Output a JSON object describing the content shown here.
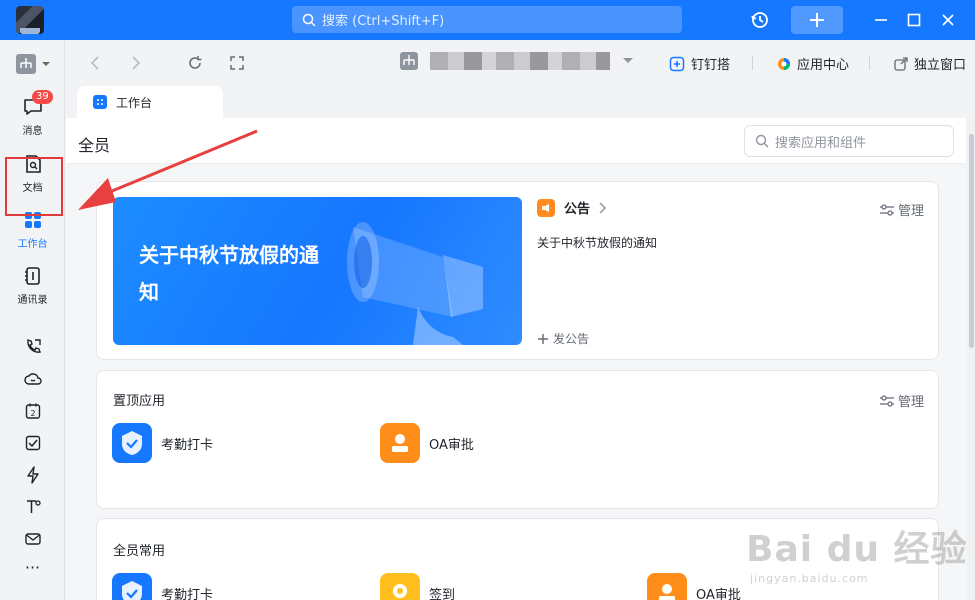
{
  "titlebar": {
    "search_placeholder": "搜索 (Ctrl+Shift+F)"
  },
  "rail": {
    "items": [
      {
        "label": "消息",
        "icon": "message-icon",
        "badge": "39"
      },
      {
        "label": "文档",
        "icon": "doc-icon"
      },
      {
        "label": "工作台",
        "icon": "workbench-icon"
      },
      {
        "label": "通讯录",
        "icon": "contacts-icon"
      }
    ],
    "small_icons": [
      "phone-icon",
      "cloud-icon",
      "calendar-icon",
      "todo-icon",
      "flash-icon",
      "pin-icon",
      "mail-icon",
      "more-icon"
    ],
    "calendar_day": "2",
    "more_glyph": "···"
  },
  "nav": {
    "links": {
      "dingdingda": "钉钉搭",
      "app_center": "应用中心",
      "detach": "独立窗口"
    }
  },
  "tab": {
    "label": "工作台"
  },
  "content": {
    "title": "全员",
    "app_search_placeholder": "搜索应用和组件",
    "banner_text": "关于中秋节放假的通知",
    "notice": {
      "title": "公告",
      "manage": "管理",
      "item": "关于中秋节放假的通知",
      "post": "发公告"
    },
    "pinned": {
      "title": "置顶应用",
      "manage": "管理",
      "apps": [
        {
          "label": "考勤打卡",
          "icon": "attendance-icon"
        },
        {
          "label": "OA审批",
          "icon": "approval-icon"
        }
      ]
    },
    "common": {
      "title": "全员常用",
      "apps": [
        {
          "label": "考勤打卡",
          "icon": "attendance-icon"
        },
        {
          "label": "签到",
          "icon": "checkin-icon"
        },
        {
          "label": "OA审批",
          "icon": "approval-icon"
        }
      ]
    }
  },
  "watermark": {
    "brand": "Bai du 经验",
    "url": "jingyan.baidu.com"
  },
  "colors": {
    "accent": "#1677ff",
    "badge": "#f54a45",
    "highlight_box": "#e23b3b",
    "orange": "#ff8d1a"
  }
}
